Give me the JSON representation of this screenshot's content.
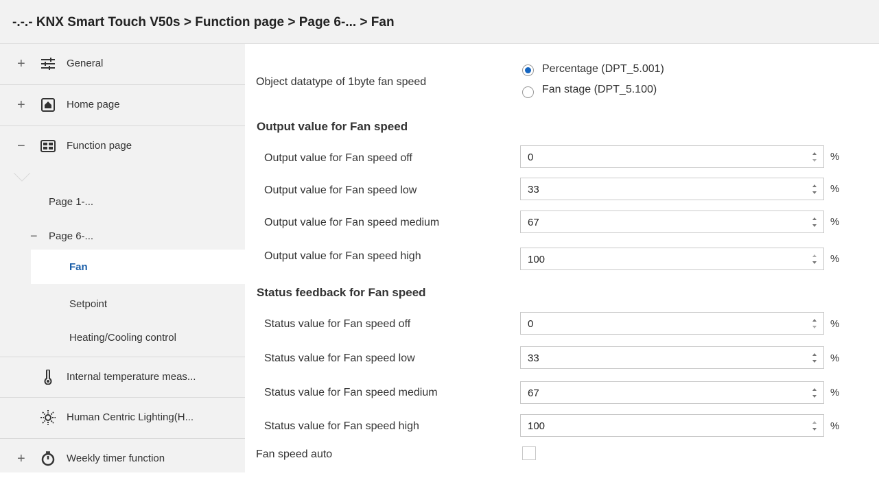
{
  "breadcrumb": "-.-.- KNX Smart Touch V50s > Function page > Page 6-... > Fan",
  "sidebar": {
    "items": [
      {
        "expander": "+",
        "icon": "sliders-icon",
        "label": "General"
      },
      {
        "expander": "+",
        "icon": "home-icon",
        "label": "Home page"
      },
      {
        "expander": "−",
        "icon": "grid-icon",
        "label": "Function page"
      },
      {
        "expander": "",
        "icon": "thermometer-icon",
        "label": "Internal temperature meas..."
      },
      {
        "expander": "",
        "icon": "sun-icon",
        "label": "Human Centric Lighting(H..."
      },
      {
        "expander": "+",
        "icon": "timer-icon",
        "label": "Weekly timer function"
      }
    ],
    "pages": [
      {
        "label": "Page 1-..."
      },
      {
        "expander": "−",
        "label": "Page 6-..."
      }
    ],
    "subitems": [
      {
        "label": "Fan",
        "selected": true
      },
      {
        "label": "Setpoint"
      },
      {
        "label": "Heating/Cooling control"
      }
    ]
  },
  "main": {
    "datatype_label": "Object datatype of 1byte fan speed",
    "datatype_options": [
      {
        "label": "Percentage (DPT_5.001)",
        "selected": true
      },
      {
        "label": "Fan stage (DPT_5.100)",
        "selected": false
      }
    ],
    "output_section": "Output value for Fan speed",
    "output_rows": [
      {
        "label": "Output value for Fan speed off",
        "value": "0",
        "unit": "%"
      },
      {
        "label": "Output value for Fan speed low",
        "value": "33",
        "unit": "%"
      },
      {
        "label": "Output value for Fan speed medium",
        "value": "67",
        "unit": "%"
      },
      {
        "label": "Output value for Fan speed high",
        "value": "100",
        "unit": "%"
      }
    ],
    "status_section": "Status feedback for Fan speed",
    "status_rows": [
      {
        "label": "Status value for Fan speed off",
        "value": "0",
        "unit": "%"
      },
      {
        "label": "Status value for Fan speed low",
        "value": "33",
        "unit": "%"
      },
      {
        "label": "Status value for Fan speed medium",
        "value": "67",
        "unit": "%"
      },
      {
        "label": "Status value for Fan speed high",
        "value": "100",
        "unit": "%"
      }
    ],
    "fan_auto_label": "Fan speed auto",
    "fan_auto_checked": false
  },
  "colors": {
    "accent": "#1565c0",
    "selected_text": "#1a5ea8",
    "sidebar_bg": "#f2f2f2"
  }
}
